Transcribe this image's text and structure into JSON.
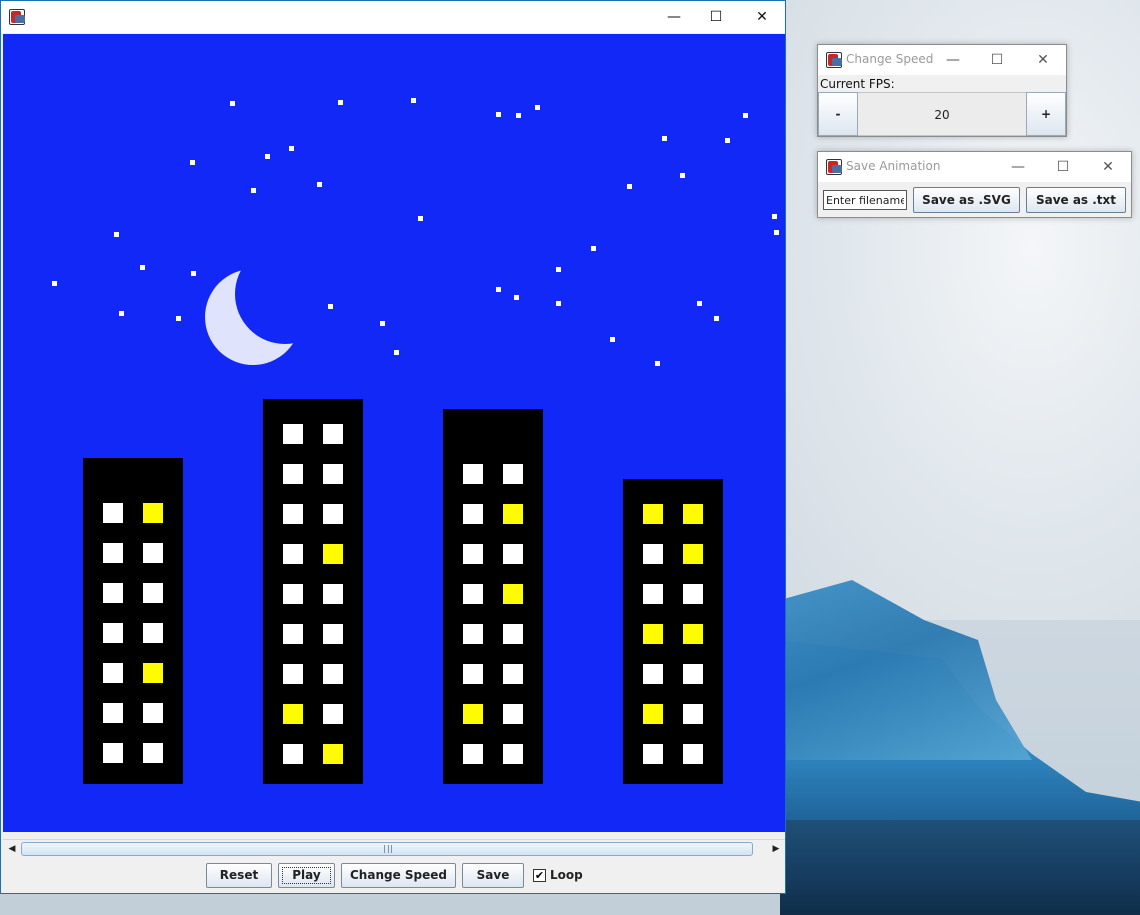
{
  "main_window": {
    "title": "",
    "controls": {
      "minimize": "—",
      "maximize": "☐",
      "close": "✕"
    },
    "canvas": {
      "sky_color": "#1228f7",
      "moon_color": "#dfe3fb",
      "star_color": "#ffffff",
      "building_color": "#000000",
      "window_lit_color": "#fffb00",
      "window_unlit_color": "#ffffff",
      "buildings": [
        {
          "windows": [
            [
              0,
              1
            ],
            [
              0,
              0
            ],
            [
              0,
              0
            ],
            [
              0,
              0
            ],
            [
              0,
              1
            ],
            [
              0,
              0
            ],
            [
              0,
              0
            ]
          ]
        },
        {
          "windows": [
            [
              0,
              0
            ],
            [
              0,
              0
            ],
            [
              0,
              0
            ],
            [
              0,
              1
            ],
            [
              0,
              0
            ],
            [
              0,
              0
            ],
            [
              0,
              0
            ],
            [
              1,
              0
            ],
            [
              0,
              1
            ]
          ]
        },
        {
          "windows": [
            [
              0,
              0
            ],
            [
              0,
              1
            ],
            [
              0,
              0
            ],
            [
              0,
              1
            ],
            [
              0,
              0
            ],
            [
              0,
              0
            ],
            [
              1,
              0
            ],
            [
              0,
              0
            ]
          ]
        },
        {
          "windows": [
            [
              1,
              1
            ],
            [
              0,
              1
            ],
            [
              0,
              0
            ],
            [
              1,
              1
            ],
            [
              0,
              0
            ],
            [
              1,
              0
            ],
            [
              0,
              0
            ]
          ]
        }
      ]
    },
    "toolbar": {
      "reset_label": "Reset",
      "play_label": "Play",
      "change_speed_label": "Change Speed",
      "save_label": "Save",
      "loop_label": "Loop",
      "loop_checked": "✔"
    },
    "scrollbar": {
      "left_arrow": "◀",
      "right_arrow": "▶"
    }
  },
  "change_speed_dialog": {
    "title": "Change Speed",
    "current_fps_label": "Current FPS:",
    "decrease_label": "-",
    "fps_value": "20",
    "increase_label": "+"
  },
  "save_dialog": {
    "title": "Save Animation",
    "filename_value": "Enter filename",
    "save_svg_label": "Save as .SVG",
    "save_txt_label": "Save as .txt"
  }
}
